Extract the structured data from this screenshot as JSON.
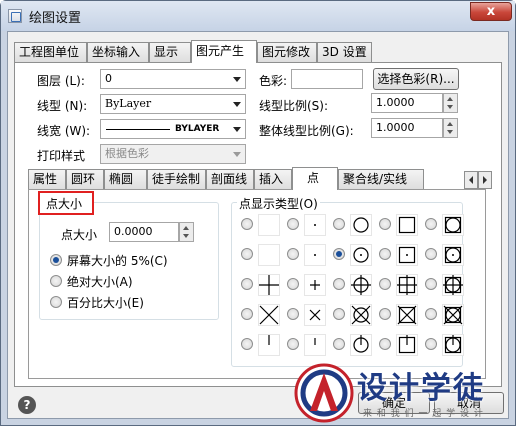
{
  "window": {
    "title": "绘图设置",
    "close_glyph": "x"
  },
  "top_tabs": [
    "工程图单位",
    "坐标输入",
    "显示",
    "图元产生",
    "图元修改",
    "3D 设置"
  ],
  "form": {
    "layer_label": "图层 (L):",
    "layer_value": "0",
    "color_label": "色彩:",
    "select_color_button": "选择色彩(R)...",
    "linetype_label": "线型 (N):",
    "linetype_value": "ByLayer",
    "linetype_scale_label": "线型比例(S):",
    "linetype_scale_value": "1.0000",
    "lineweight_label": "线宽 (W):",
    "lineweight_value": "BYLAYER",
    "global_scale_label": "整体线型比例(G):",
    "global_scale_value": "1.0000",
    "print_style_label": "打印样式",
    "print_style_value": "根据色彩"
  },
  "sub_tabs": [
    "属性",
    "圆环",
    "椭圆",
    "徒手绘制",
    "剖面线",
    "插入",
    "点",
    "聚合线/实线"
  ],
  "point_size": {
    "group_title": "点大小",
    "size_label": "点大小",
    "size_value": "0.0000",
    "options": [
      "屏幕大小的 5%(C)",
      "绝对大小(A)",
      "百分比大小(E)"
    ],
    "selected_option": 0
  },
  "point_display": {
    "group_title": "点显示类型(O)",
    "selected_index": 7,
    "symbols": [
      "blank",
      "dot",
      "circle",
      "square",
      "square-circle",
      "blank",
      "dot",
      "circle-dot",
      "square-dot",
      "square-circle-dot",
      "plus",
      "plus-small",
      "circle-plus",
      "square-plus",
      "square-circle-plus",
      "x",
      "x-small",
      "circle-x",
      "square-x",
      "square-circle-x",
      "tick",
      "tick-small",
      "circle-tick",
      "square-tick",
      "square-circle-tick"
    ]
  },
  "buttons": {
    "ok": "确定",
    "cancel": "取消",
    "help": "?"
  },
  "watermark": {
    "text": "设计学徒",
    "subtext": "来 和 我 们 一 起 学 设 计",
    "logo_letter": "A"
  }
}
